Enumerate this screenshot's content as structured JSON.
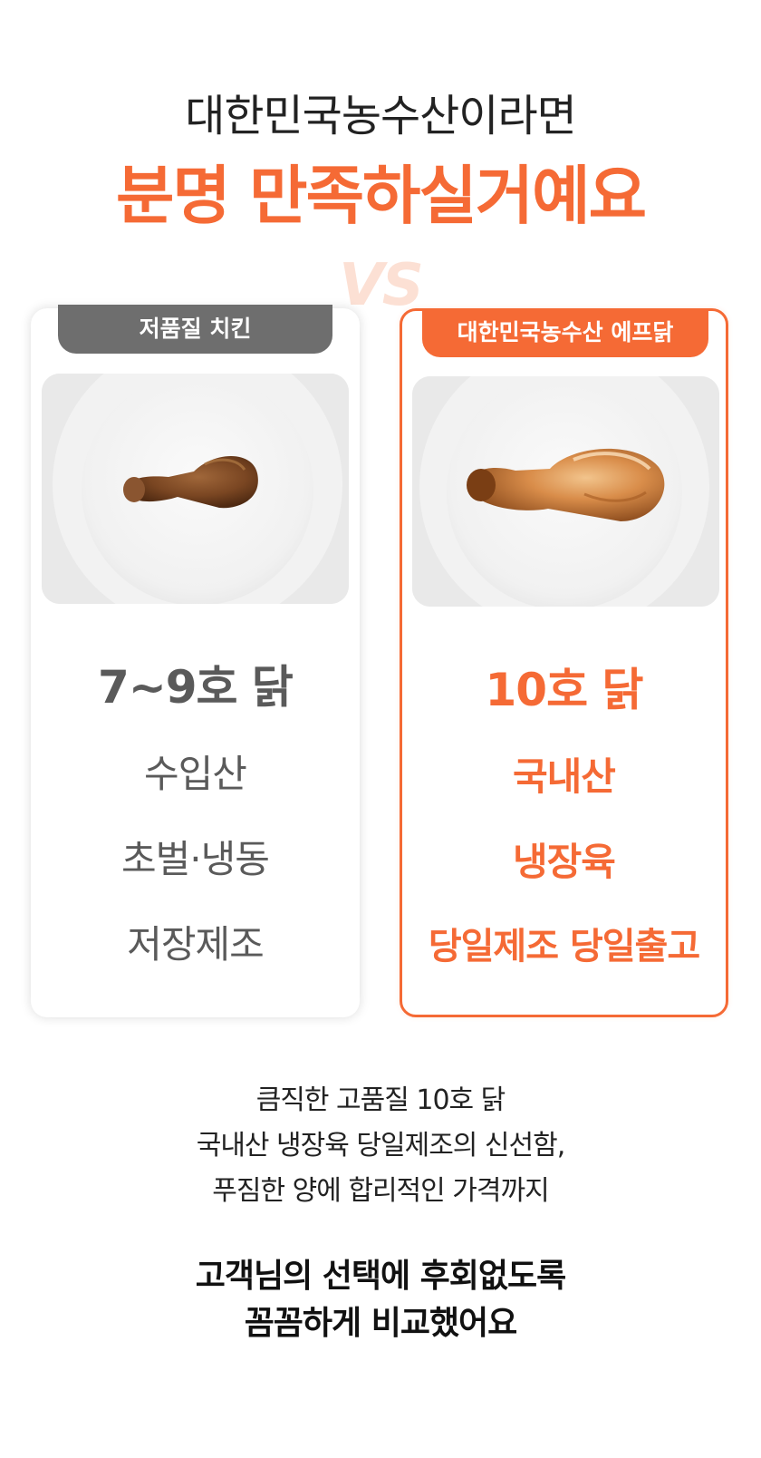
{
  "header": {
    "subtitle": "대한민국농수산이라면",
    "title": "분명 만족하실거예요"
  },
  "vs_label": "VS",
  "left_card": {
    "tab_label": "저품질 치킨",
    "image_icon": "chicken-drumstick-small-icon",
    "lines": [
      "7~9호 닭",
      "수입산",
      "초벌·냉동",
      "저장제조"
    ]
  },
  "right_card": {
    "tab_label": "대한민국농수산 에프닭",
    "image_icon": "chicken-drumstick-large-icon",
    "lines": [
      "10호 닭",
      "국내산",
      "냉장육",
      "당일제조 당일출고"
    ]
  },
  "description": [
    "큼직한 고품질 10호 닭",
    "국내산 냉장육 당일제조의 신선함,",
    "푸짐한 양에 합리적인 가격까지"
  ],
  "closing": [
    "고객님의 선택에 후회없도록",
    "꼼꼼하게 비교했어요"
  ],
  "colors": {
    "accent": "#f56a35",
    "gray_tab": "#6e6e6e",
    "gray_text": "#5a5a5a",
    "vs": "#fce0d4"
  }
}
